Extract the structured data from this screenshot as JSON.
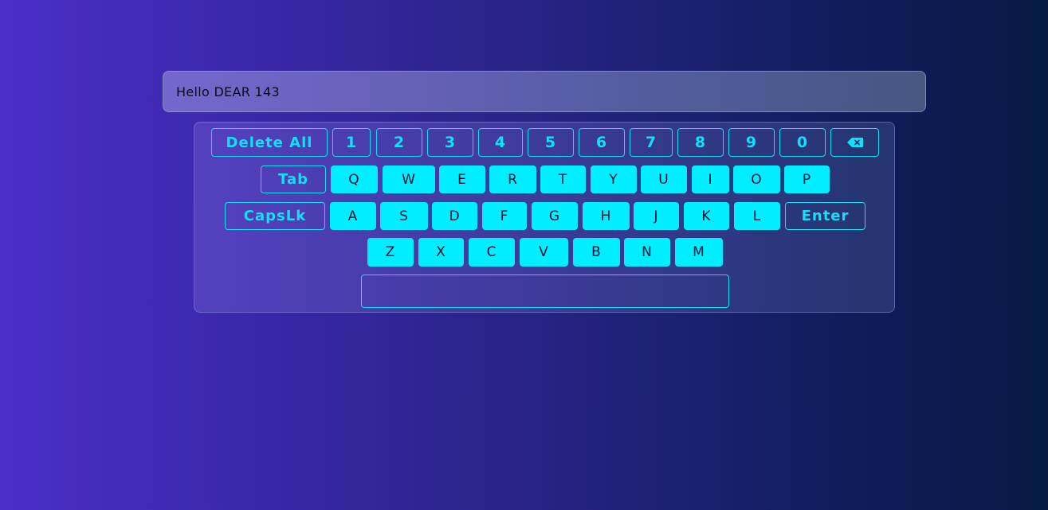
{
  "display": {
    "text": "Hello DEAR 143"
  },
  "keyboard": {
    "row1": {
      "delete_all": "Delete All",
      "digits": [
        "1",
        "2",
        "3",
        "4",
        "5",
        "6",
        "7",
        "8",
        "9",
        "0"
      ],
      "backspace_icon": "backspace-icon"
    },
    "row2": {
      "tab": "Tab",
      "letters": [
        "Q",
        "W",
        "E",
        "R",
        "T",
        "Y",
        "U",
        "I",
        "O",
        "P"
      ]
    },
    "row3": {
      "capslock": "CapsLk",
      "letters": [
        "A",
        "S",
        "D",
        "F",
        "G",
        "H",
        "J",
        "K",
        "L"
      ],
      "enter": "Enter"
    },
    "row4": {
      "letters": [
        "Z",
        "X",
        "C",
        "V",
        "B",
        "N",
        "M"
      ]
    },
    "row5": {
      "space": ""
    }
  },
  "colors": {
    "accent": "#00eeff",
    "key_text": "#0a1030"
  }
}
